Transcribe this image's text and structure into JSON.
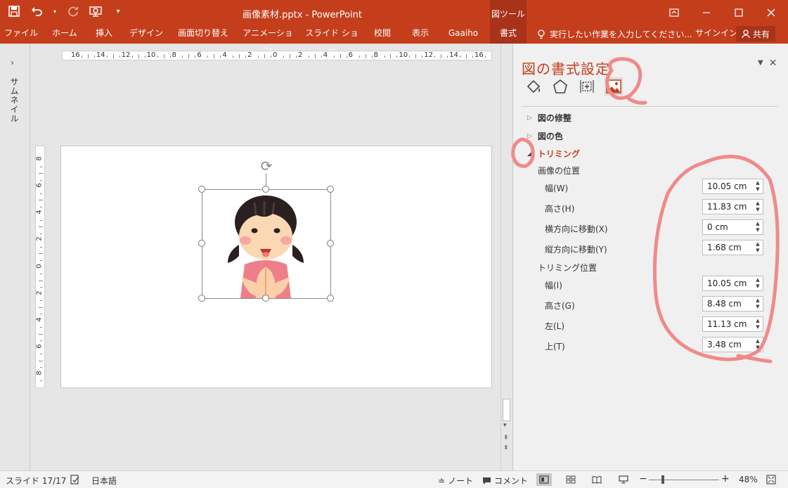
{
  "titlebar": {
    "doc_title": "画像素材.pptx - PowerPoint",
    "tool_group": "図ツール",
    "accent_color": "#c43e1c"
  },
  "qat": {
    "icons": [
      "save-icon",
      "undo-icon",
      "redo-icon",
      "presentation-icon",
      "customize-icon"
    ]
  },
  "window": {
    "icons": [
      "ribbon-display-icon",
      "minimize-icon",
      "maximize-icon",
      "close-icon"
    ]
  },
  "tabs": {
    "file": "ファイル",
    "home": "ホーム",
    "insert": "挿入",
    "design": "デザイン",
    "transitions": "画面切り替え",
    "animations": "アニメーション",
    "slideshow": "スライド ショー",
    "review": "校閲",
    "view": "表示",
    "gaaiho": "Gaaiho",
    "format": "書式",
    "tellme": "実行したい作業を入力してください...",
    "signin": "サインイン",
    "share": "共有"
  },
  "thumbnails": {
    "label": "サムネイル"
  },
  "rulers": {
    "h": [
      "16",
      "14",
      "12",
      "10",
      "8",
      "6",
      "4",
      "2",
      "0",
      "2",
      "4",
      "6",
      "8",
      "10",
      "12",
      "14",
      "16"
    ],
    "v": [
      "8",
      "6",
      "4",
      "2",
      "0",
      "2",
      "4",
      "6",
      "8"
    ]
  },
  "pane": {
    "title": "図の書式設定",
    "sections": {
      "corrections": "図の修整",
      "color": "図の色",
      "crop": "トリミング"
    },
    "picture_position": {
      "heading": "画像の位置",
      "width_label": "幅(W)",
      "width": "10.05 cm",
      "height_label": "高さ(H)",
      "height": "11.83 cm",
      "offset_x_label": "横方向に移動(X)",
      "offset_x": "0 cm",
      "offset_y_label": "縦方向に移動(Y)",
      "offset_y": "1.68 cm"
    },
    "crop_position": {
      "heading": "トリミング位置",
      "width_label": "幅(I)",
      "width": "10.05 cm",
      "height_label": "高さ(G)",
      "height": "8.48 cm",
      "left_label": "左(L)",
      "left": "11.13 cm",
      "top_label": "上(T)",
      "top": "3.48 cm"
    }
  },
  "status": {
    "slide": "スライド 17/17",
    "language": "日本語",
    "notes": "ノート",
    "comments": "コメント",
    "zoom": "48%"
  }
}
